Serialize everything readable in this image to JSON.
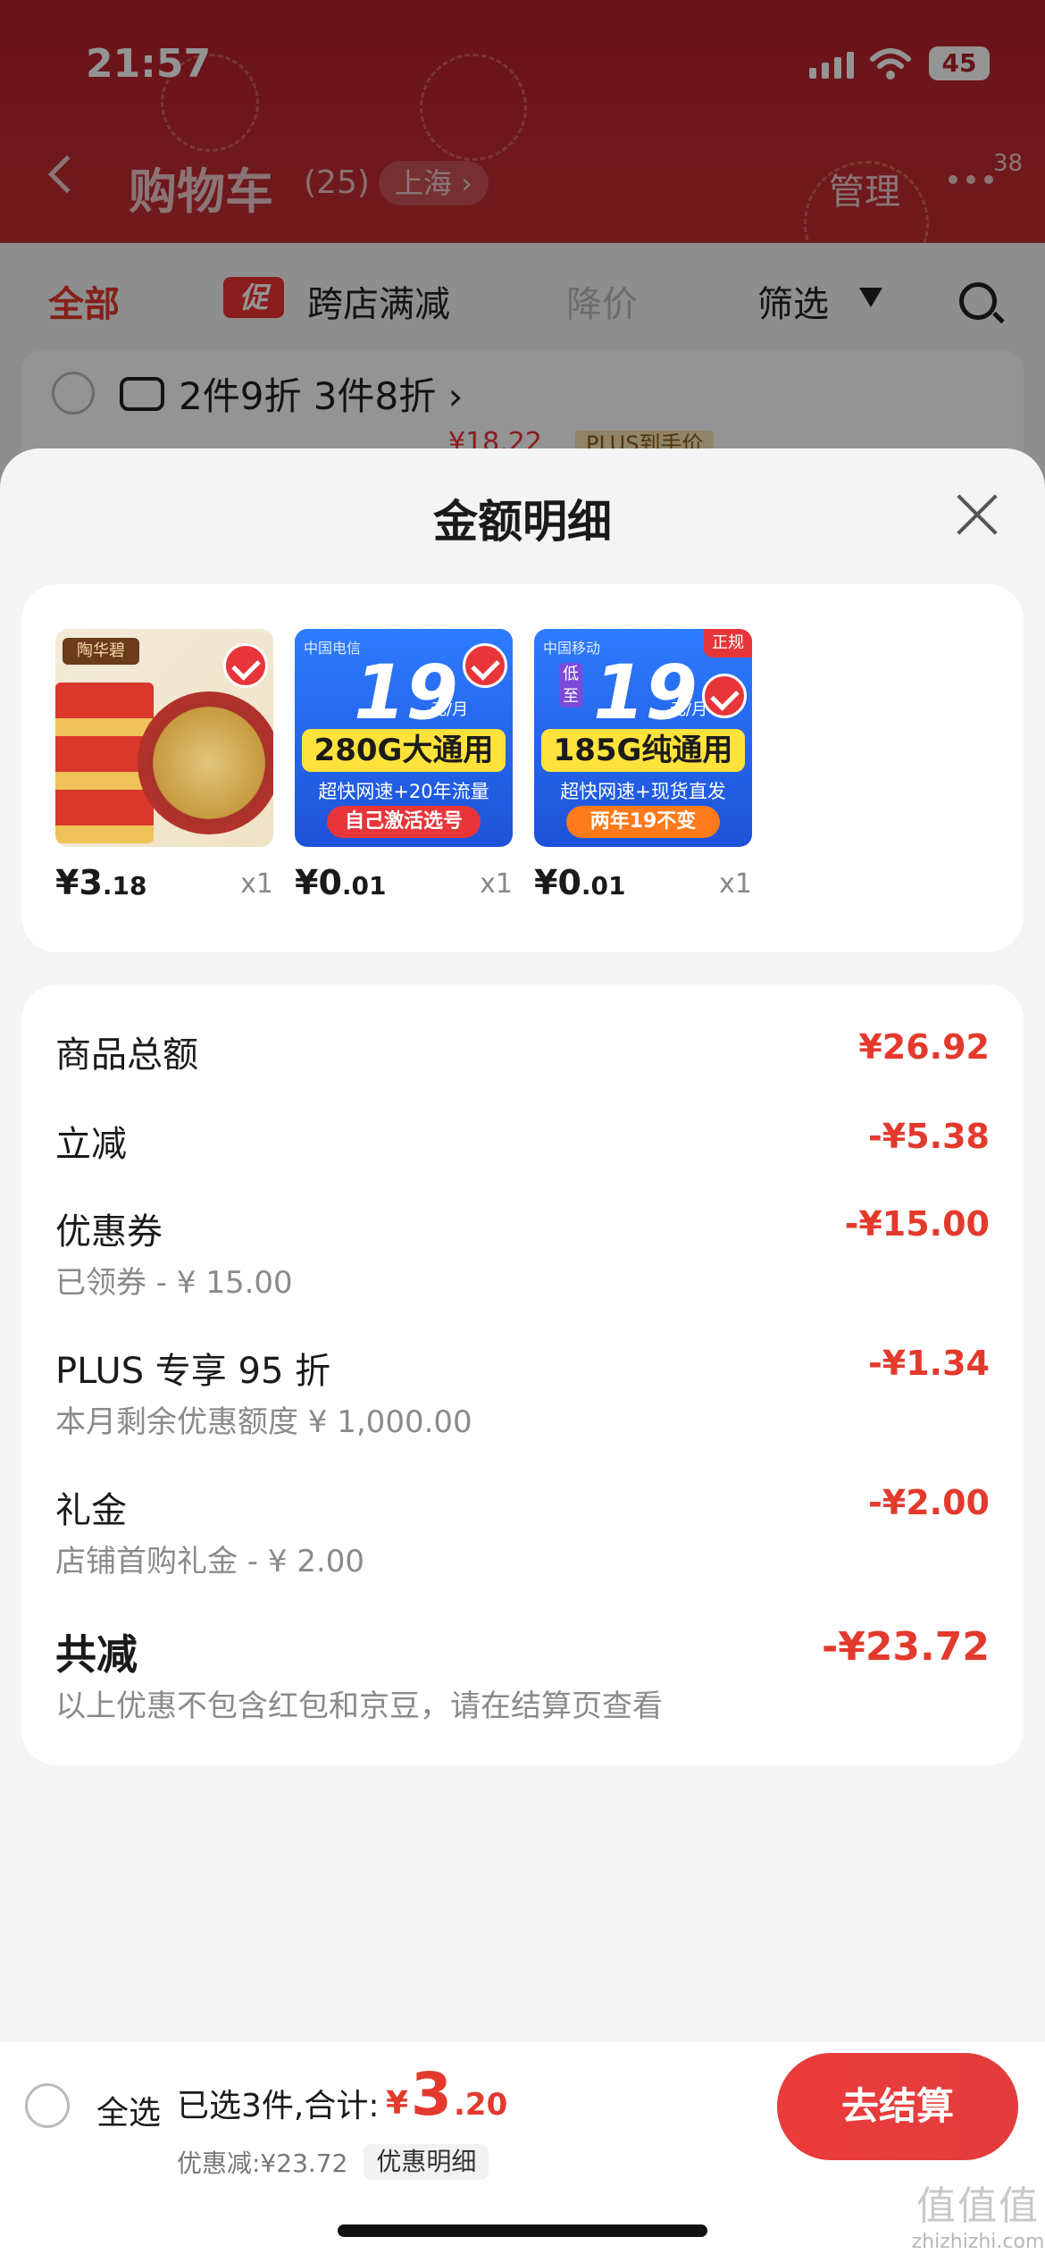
{
  "status_bar": {
    "time": "21:57",
    "battery": "45"
  },
  "nav": {
    "title": "购物车",
    "count": "(25)",
    "city": "上海 ›",
    "manage": "管理",
    "badge": "38"
  },
  "filters": {
    "all": "全部",
    "promo_tag": "促",
    "cross_store": "跨店满减",
    "price_drop": "降价",
    "filter": "筛选"
  },
  "store_row": {
    "promo": "2件9折 3件8折 ›",
    "peek_price": "¥18.22",
    "peek_tag": "PLUS到手价"
  },
  "sheet": {
    "title": "金额明细",
    "products": [
      {
        "price_int": "¥3",
        "price_dec": ".18",
        "qty": "x1",
        "brand": "陶华碧"
      },
      {
        "price_int": "¥0",
        "price_dec": ".01",
        "qty": "x1",
        "carrier": "中国电信",
        "big": "19",
        "unit": "元/月",
        "band": "280G大通用",
        "sub": "超快网速+20年流量",
        "pill": "自己激活选号"
      },
      {
        "price_int": "¥0",
        "price_dec": ".01",
        "qty": "x1",
        "carrier": "中国移动",
        "big": "19",
        "unit": "元/月",
        "band": "185G纯通用",
        "sub": "超快网速+现货直发",
        "pill": "两年19不变",
        "ribbon": "正规",
        "low": "低至"
      }
    ],
    "rows": [
      {
        "label": "商品总额",
        "amount": "¥26.92",
        "sub": ""
      },
      {
        "label": "立减",
        "amount": "-¥5.38",
        "sub": ""
      },
      {
        "label": "优惠券",
        "amount": "-¥15.00",
        "sub": "已领券 - ¥ 15.00"
      },
      {
        "label": "PLUS 专享 95 折",
        "amount": "-¥1.34",
        "sub": "本月剩余优惠额度 ¥ 1,000.00"
      },
      {
        "label": "礼金",
        "amount": "-¥2.00",
        "sub": "店铺首购礼金 - ¥ 2.00"
      }
    ],
    "total": {
      "label": "共减",
      "amount": "-¥23.72",
      "note": "以上优惠不包含红包和京豆，请在结算页查看"
    }
  },
  "bottom_bar": {
    "select_all": "全选",
    "selected": "已选3件,合计:",
    "sum_yen": "¥",
    "sum_int": "3",
    "sum_dec": ".20",
    "discount": "优惠减:¥23.72",
    "discount_detail": "优惠明细",
    "checkout": "去结算"
  },
  "watermark": {
    "logo": "值值值",
    "domain": "zhizhizhi.com"
  },
  "colors": {
    "accent": "#e33a2d",
    "header_red": "#bf2a32",
    "checkout": "#ec3b3b"
  }
}
